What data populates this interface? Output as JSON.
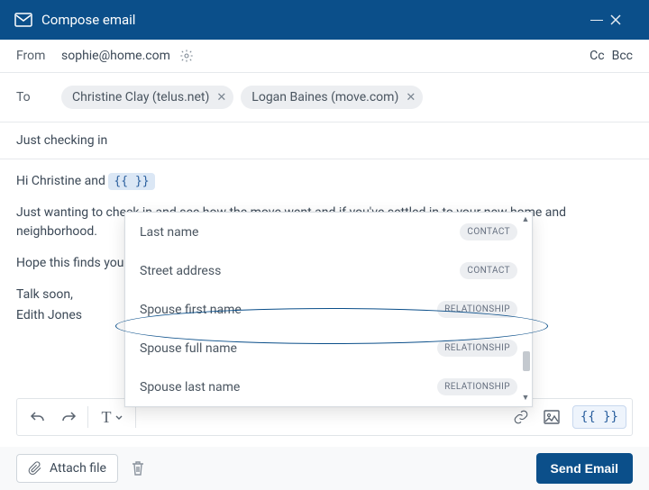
{
  "titlebar": {
    "title": "Compose email"
  },
  "from": {
    "label": "From",
    "address": "sophie@home.com",
    "cc": "Cc",
    "bcc": "Bcc"
  },
  "to": {
    "label": "To",
    "chips": [
      {
        "text": "Christine Clay (telus.net)"
      },
      {
        "text": "Logan Baines (move.com)"
      }
    ]
  },
  "subject": "Just checking in",
  "body": {
    "greeting_prefix": "Hi Christine and ",
    "token": "{{  }}",
    "p1": "Just wanting to check in and see how the move went and if you've settled in to your new home and neighborhood.",
    "p2": "Hope this finds you well.",
    "sign1": "Talk soon,",
    "sign2": "Edith Jones"
  },
  "dropdown": {
    "items": [
      {
        "label": "Last name",
        "kind": "CONTACT"
      },
      {
        "label": "Street address",
        "kind": "CONTACT"
      },
      {
        "label": "Spouse first name",
        "kind": "RELATIONSHIP"
      },
      {
        "label": "Spouse full name",
        "kind": "RELATIONSHIP"
      },
      {
        "label": "Spouse last name",
        "kind": "RELATIONSHIP"
      }
    ]
  },
  "toolbar": {
    "token_button": "{{  }}"
  },
  "footer": {
    "attach": "Attach file",
    "send": "Send Email"
  }
}
